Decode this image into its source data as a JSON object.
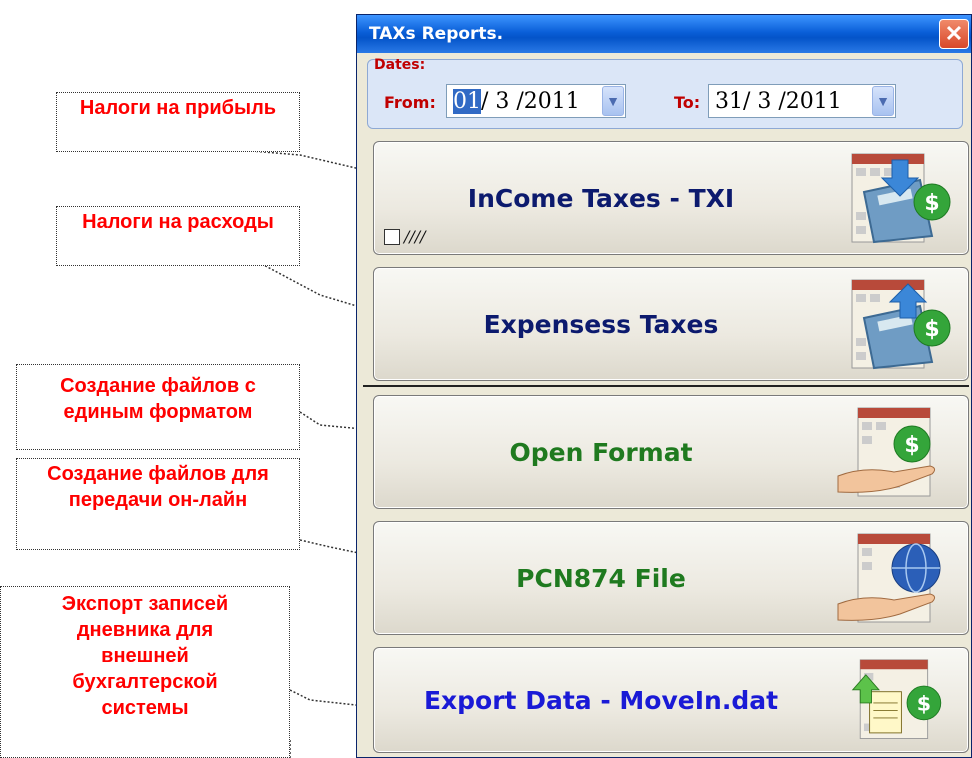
{
  "annotations": [
    {
      "text": "Налоги на прибыль"
    },
    {
      "text": "Налоги на расходы"
    },
    {
      "text": "Создание файлов с единым форматом"
    },
    {
      "text": "Создание файлов для передачи он-лайн"
    },
    {
      "text": "Экспорт записей дневника для внешней бухгалтерской системы"
    }
  ],
  "window": {
    "title": "TAXs Reports.",
    "close_label": "✕"
  },
  "dates": {
    "legend": "Dates:",
    "from_label": "From:",
    "from_day": "01",
    "from_rest": "/ 3 /2011",
    "to_label": "To:",
    "to_value": "31/ 3 /2011"
  },
  "buttons": [
    {
      "label": "InCome Taxes - TXI",
      "color": "#0c1a6e",
      "icon": "calculator-download-dollar-icon",
      "checkbox_text": "////"
    },
    {
      "label": "Expensess Taxes",
      "color": "#0c1a6e",
      "icon": "calculator-upload-dollar-icon"
    },
    {
      "label": "Open Format",
      "color": "#1f7a1f",
      "icon": "hand-dollar-calendar-icon"
    },
    {
      "label": "PCN874 File",
      "color": "#1f7a1f",
      "icon": "hand-globe-calendar-icon"
    },
    {
      "label": "Export Data - MoveIn.dat",
      "color": "#1a1ad6",
      "icon": "document-export-dollar-icon"
    }
  ]
}
